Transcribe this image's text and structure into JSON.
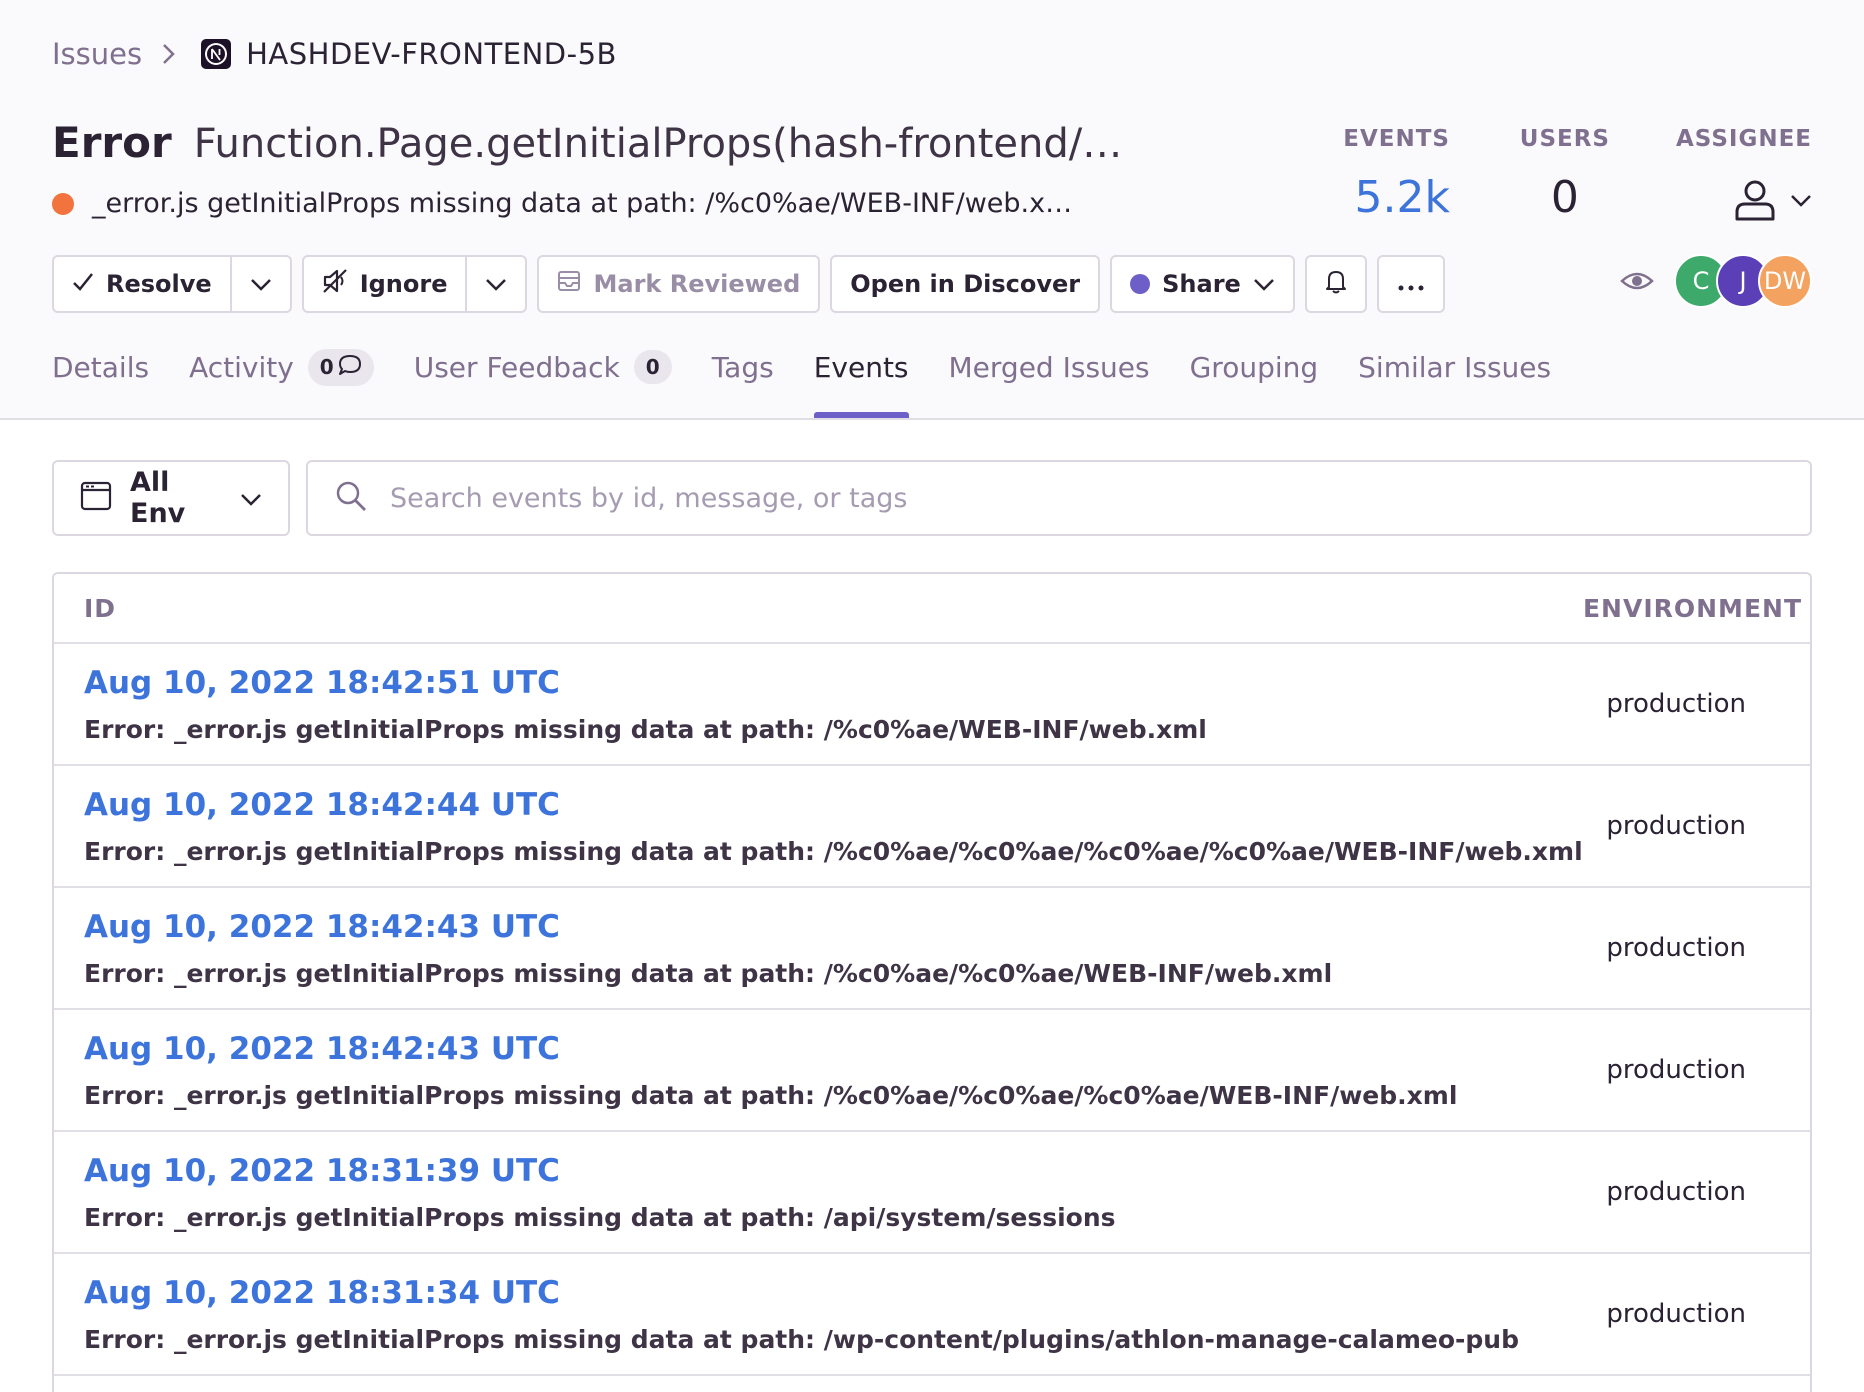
{
  "breadcrumb": {
    "issues": "Issues",
    "project": "HASHDEV-FRONTEND-5B"
  },
  "issue": {
    "type": "Error",
    "title": "Function.Page.getInitialProps(hash-frontend/…",
    "subtitle": "_error.js getInitialProps missing data at path: /%c0%ae/WEB-INF/web.x…"
  },
  "stats": {
    "events_label": "EVENTS",
    "events_value": "5.2k",
    "users_label": "USERS",
    "users_value": "0",
    "assignee_label": "ASSIGNEE"
  },
  "actions": {
    "resolve": "Resolve",
    "ignore": "Ignore",
    "mark_reviewed": "Mark Reviewed",
    "open_in_discover": "Open in Discover",
    "share": "Share"
  },
  "participants": [
    {
      "initials": "C",
      "color": "#3daa6b"
    },
    {
      "initials": "J",
      "color": "#5b3fb6"
    },
    {
      "initials": "DW",
      "color": "#f3a25f"
    }
  ],
  "tabs": {
    "details": "Details",
    "activity": "Activity",
    "activity_count": "0",
    "user_feedback": "User Feedback",
    "user_feedback_count": "0",
    "tags": "Tags",
    "events": "Events",
    "merged_issues": "Merged Issues",
    "grouping": "Grouping",
    "similar_issues": "Similar Issues"
  },
  "filters": {
    "env": "All Env",
    "search_placeholder": "Search events by id, message, or tags"
  },
  "table": {
    "col_id": "ID",
    "col_env": "ENVIRONMENT",
    "rows": [
      {
        "date": "Aug 10, 2022 18:42:51 UTC",
        "message": "Error: _error.js getInitialProps missing data at path: /%c0%ae/WEB-INF/web.xml",
        "env": "production"
      },
      {
        "date": "Aug 10, 2022 18:42:44 UTC",
        "message": "Error: _error.js getInitialProps missing data at path: /%c0%ae/%c0%ae/%c0%ae/%c0%ae/WEB-INF/web.xml",
        "env": "production"
      },
      {
        "date": "Aug 10, 2022 18:42:43 UTC",
        "message": "Error: _error.js getInitialProps missing data at path: /%c0%ae/%c0%ae/WEB-INF/web.xml",
        "env": "production"
      },
      {
        "date": "Aug 10, 2022 18:42:43 UTC",
        "message": "Error: _error.js getInitialProps missing data at path: /%c0%ae/%c0%ae/%c0%ae/WEB-INF/web.xml",
        "env": "production"
      },
      {
        "date": "Aug 10, 2022 18:31:39 UTC",
        "message": "Error: _error.js getInitialProps missing data at path: /api/system/sessions",
        "env": "production"
      },
      {
        "date": "Aug 10, 2022 18:31:34 UTC",
        "message": "Error: _error.js getInitialProps missing data at path: /wp-content/plugins/athlon-manage-calameo-pub",
        "env": "production"
      }
    ]
  }
}
